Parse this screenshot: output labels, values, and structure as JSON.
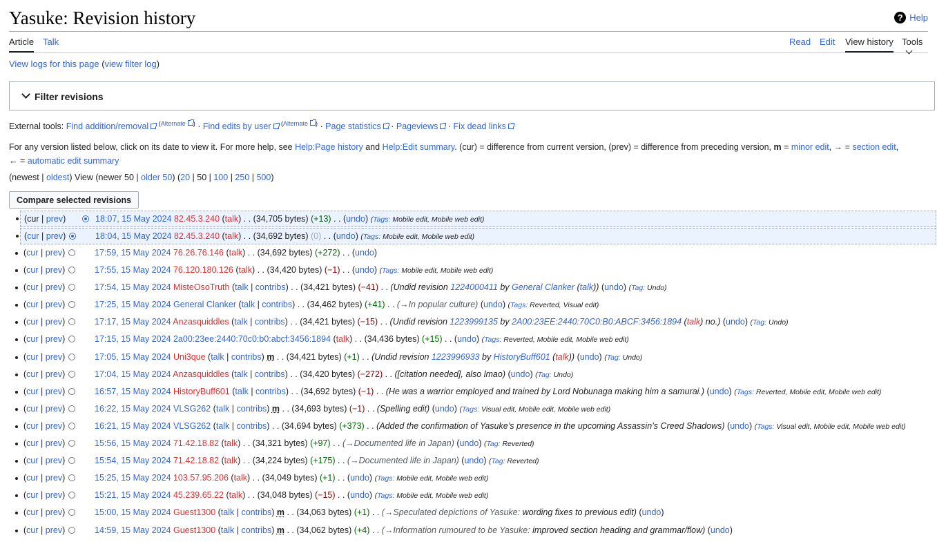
{
  "page": {
    "title": "Yasuke: Revision history",
    "help": "Help"
  },
  "tabs": {
    "article": "Article",
    "talk": "Talk",
    "read": "Read",
    "edit": "Edit",
    "view_history": "View history",
    "tools": "Tools"
  },
  "logs": {
    "view_logs": "View logs for this page",
    "filter_log": "view filter log"
  },
  "filter": {
    "label": "Filter revisions"
  },
  "external": {
    "prefix": "External tools:",
    "items": [
      "Find addition/removal",
      "Find edits by user",
      "Page statistics",
      "Pageviews",
      "Fix dead links"
    ],
    "alternate": "Alternate"
  },
  "explanation": {
    "t1": "For any version listed below, click on its date to view it. For more help, see ",
    "l1": "Help:Page history",
    "t2": " and ",
    "l2": "Help:Edit summary",
    "t3": ". (cur) = difference from current version, (prev) = difference from preceding version, ",
    "m": "m",
    "t4": " = ",
    "l3": "minor edit",
    "t5": ", → = ",
    "l4": "section edit",
    "t6": ",",
    "t7": "← = ",
    "l5": "automatic edit summary"
  },
  "pager": {
    "newest": "newest",
    "oldest": "oldest",
    "view": "View",
    "newer": "newer 50",
    "older": "older 50",
    "sizes": [
      "20",
      "50",
      "100",
      "250",
      "500"
    ]
  },
  "compare_button": "Compare selected revisions",
  "common": {
    "cur": "cur",
    "prev": "prev",
    "talk": "talk",
    "contribs": "contribs",
    "undo": "undo",
    "minor": "m"
  },
  "revisions": [
    {
      "date": "18:07, 15 May 2024",
      "user": "82.45.3.240",
      "ip": true,
      "bytes": "34,705 bytes",
      "diff": "+13",
      "sum": [],
      "tagLabel": "Tags:",
      "tags": "Mobile edit, Mobile web edit",
      "radio": "on"
    },
    {
      "date": "18:04, 15 May 2024",
      "user": "82.45.3.240",
      "ip": true,
      "bytes": "34,692 bytes",
      "diff": "0",
      "sum": [],
      "tagLabel": "Tags:",
      "tags": "Mobile edit, Mobile web edit",
      "radio": "on"
    },
    {
      "date": "17:59, 15 May 2024",
      "user": "76.26.76.146",
      "ip": true,
      "bytes": "34,692 bytes",
      "diff": "+272",
      "sum": [],
      "tagLabel": "",
      "tags": ""
    },
    {
      "date": "17:55, 15 May 2024",
      "user": "76.120.180.126",
      "ip": true,
      "bytes": "34,420 bytes",
      "diff": "−1",
      "sum": [],
      "tagLabel": "Tags:",
      "tags": "Mobile edit, Mobile web edit"
    },
    {
      "date": "17:54, 15 May 2024",
      "user": "MisteOsoTruth",
      "bytes": "34,421 bytes",
      "diff": "−41",
      "sum": [
        {
          "t": "(Undid revision "
        },
        {
          "l": "1224000411"
        },
        {
          "t": " by "
        },
        {
          "l": "General Clanker"
        },
        {
          "t": " ("
        },
        {
          "l": "talk"
        },
        {
          "t": "))"
        }
      ],
      "tagLabel": "Tag:",
      "tags": "Undo"
    },
    {
      "date": "17:25, 15 May 2024",
      "user": "General Clanker",
      "userBlue": true,
      "bytes": "34,462 bytes",
      "diff": "+41",
      "sum": [
        {
          "g": "(→In popular culture)"
        }
      ],
      "tagLabel": "Tags:",
      "tags": "Reverted, Visual edit"
    },
    {
      "date": "17:17, 15 May 2024",
      "user": "Anzasquiddles",
      "bytes": "34,421 bytes",
      "diff": "−15",
      "sum": [
        {
          "t": "(Undid revision "
        },
        {
          "l": "1223999135"
        },
        {
          "t": " by "
        },
        {
          "l": "2A00:23EE:2440:70C0:B0:ABCF:3456:1894"
        },
        {
          "t": " ("
        },
        {
          "r": "talk"
        },
        {
          "t": ") no.)"
        }
      ],
      "tagLabel": "Tag:",
      "tags": "Undo"
    },
    {
      "date": "17:15, 15 May 2024",
      "user": "2a00:23ee:2440:70c0:b0:abcf:3456:1894",
      "ip": true,
      "userBlue": true,
      "bytes": "34,436 bytes",
      "diff": "+15",
      "sum": [],
      "tagLabel": "Tags:",
      "tags": "Reverted, Mobile edit, Mobile web edit"
    },
    {
      "date": "17:05, 15 May 2024",
      "user": "Uni3que",
      "minor": true,
      "bytes": "34,421 bytes",
      "diff": "+1",
      "sum": [
        {
          "t": "(Undid revision "
        },
        {
          "l": "1223996933"
        },
        {
          "t": " by "
        },
        {
          "l": "HistoryBuff601"
        },
        {
          "t": " ("
        },
        {
          "r": "talk"
        },
        {
          "t": "))"
        }
      ],
      "tagLabel": "Tag:",
      "tags": "Undo"
    },
    {
      "date": "17:04, 15 May 2024",
      "user": "Anzasquiddles",
      "bytes": "34,420 bytes",
      "diff": "−272",
      "sum": [
        {
          "t": "([citation needed], also lmao)"
        }
      ],
      "tagLabel": "Tag:",
      "tags": "Undo"
    },
    {
      "date": "16:57, 15 May 2024",
      "user": "HistoryBuff601",
      "bytes": "34,692 bytes",
      "diff": "−1",
      "sum": [
        {
          "t": "(He was a warrior employed and trained by Lord Nobunaga making him a samurai.)"
        }
      ],
      "tagLabel": "Tags:",
      "tags": "Reverted, Mobile edit, Mobile web edit"
    },
    {
      "date": "16:22, 15 May 2024",
      "user": "VLSG262",
      "userBlue": true,
      "minor": true,
      "bytes": "34,693 bytes",
      "diff": "−1",
      "sum": [
        {
          "t": "(Spelling edit)"
        }
      ],
      "tagLabel": "Tags:",
      "tags": "Visual edit, Mobile edit, Mobile web edit"
    },
    {
      "date": "16:21, 15 May 2024",
      "user": "VLSG262",
      "userBlue": true,
      "bytes": "34,694 bytes",
      "diff": "+373",
      "sum": [
        {
          "t": "(Added the confirmation of Yasuke’s presence in the upcoming Assassin’s Creed Shadows)"
        }
      ],
      "tagLabel": "Tags:",
      "tags": "Visual edit, Mobile edit, Mobile web edit"
    },
    {
      "date": "15:56, 15 May 2024",
      "user": "71.42.18.82",
      "ip": true,
      "bytes": "34,321 bytes",
      "diff": "+97",
      "sum": [
        {
          "g": "(→Documented life in Japan)"
        }
      ],
      "tagLabel": "Tag:",
      "tags": "Reverted"
    },
    {
      "date": "15:54, 15 May 2024",
      "user": "71.42.18.82",
      "ip": true,
      "bytes": "34,224 bytes",
      "diff": "+175",
      "sum": [
        {
          "g": "(→Documented life in Japan)"
        }
      ],
      "tagLabel": "Tag:",
      "tags": "Reverted"
    },
    {
      "date": "15:25, 15 May 2024",
      "user": "103.57.95.206",
      "ip": true,
      "bytes": "34,049 bytes",
      "diff": "+1",
      "sum": [],
      "tagLabel": "Tags:",
      "tags": "Mobile edit, Mobile web edit"
    },
    {
      "date": "15:21, 15 May 2024",
      "user": "45.239.65.22",
      "ip": true,
      "bytes": "34,048 bytes",
      "diff": "−15",
      "sum": [],
      "tagLabel": "Tags:",
      "tags": "Mobile edit, Mobile web edit"
    },
    {
      "date": "15:00, 15 May 2024",
      "user": "Guest1300",
      "minor": true,
      "bytes": "34,063 bytes",
      "diff": "+1",
      "sum": [
        {
          "g": "(→Speculated depictions of Yasuke: "
        },
        {
          "t": "wording fixes to previous edit)"
        }
      ],
      "tagLabel": "",
      "tags": ""
    },
    {
      "date": "14:59, 15 May 2024",
      "user": "Guest1300",
      "minor": true,
      "bytes": "34,062 bytes",
      "diff": "+4",
      "sum": [
        {
          "g": "(→Information rumoured to be Yasuke: "
        },
        {
          "t": "improved section heading and grammar/flow)"
        }
      ],
      "tagLabel": "",
      "tags": ""
    }
  ]
}
